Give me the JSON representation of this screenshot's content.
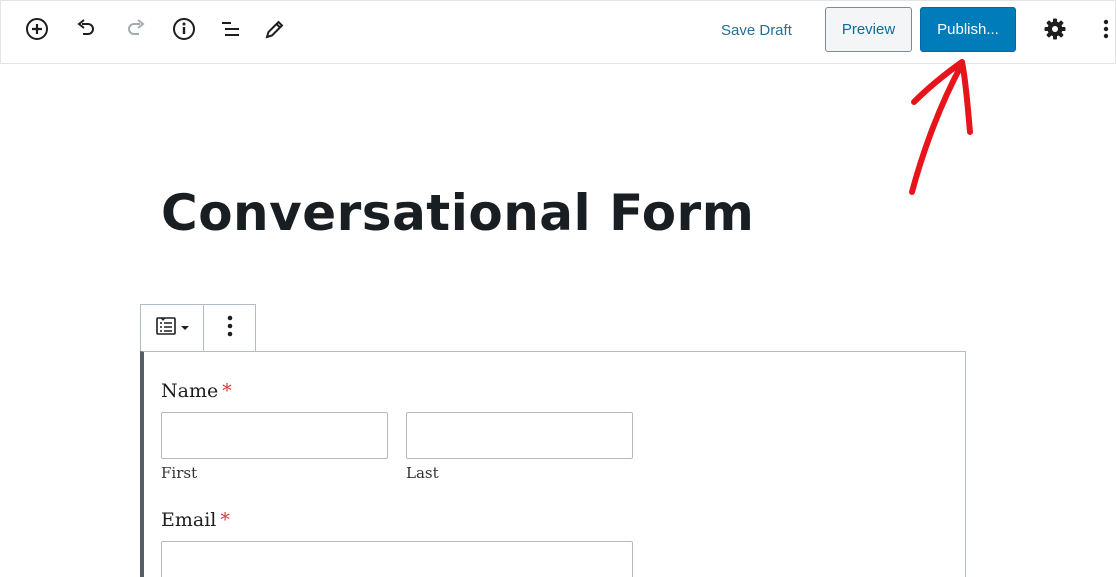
{
  "toolbar": {
    "icons": [
      "add-block-icon",
      "undo-icon",
      "redo-icon",
      "info-icon",
      "outline-icon",
      "edit-icon"
    ],
    "save_draft": "Save Draft",
    "preview": "Preview",
    "publish": "Publish...",
    "settings_icon": "gear-icon",
    "more_icon": "more-vertical-icon"
  },
  "colors": {
    "accent": "#007cba",
    "link": "#2a6e94",
    "annotation": "#e8141b",
    "required": "#d63638"
  },
  "post": {
    "title": "Conversational Form"
  },
  "block_toolbar": {
    "switcher_icon": "form-block-icon",
    "more_icon": "more-vertical-icon"
  },
  "form": {
    "name_label": "Name",
    "name_required": "*",
    "first_sublabel": "First",
    "last_sublabel": "Last",
    "email_label": "Email",
    "email_required": "*"
  }
}
